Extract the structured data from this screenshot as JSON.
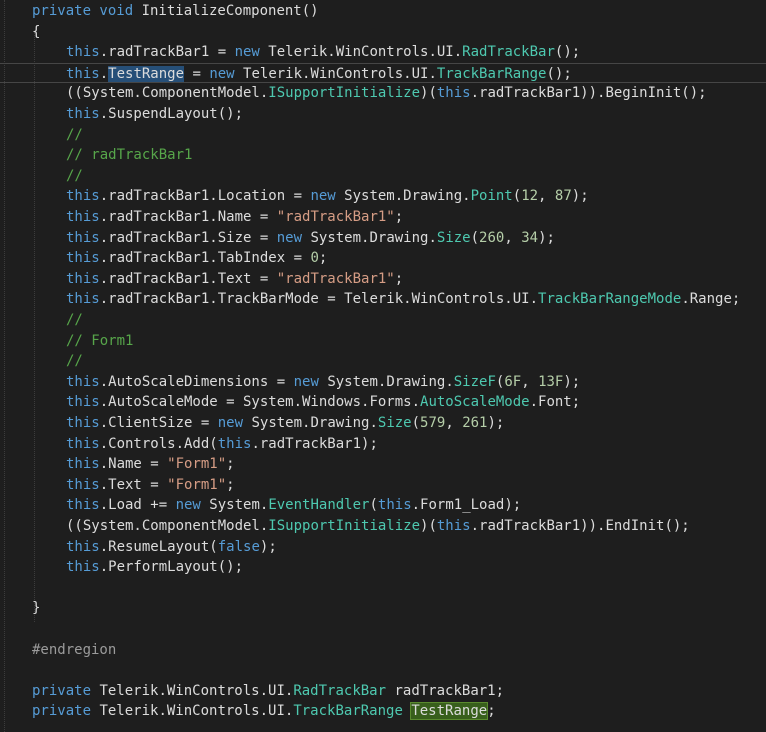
{
  "editor": {
    "lines": [
      {
        "indent": 32,
        "tokens": [
          {
            "t": "private void ",
            "c": "kw"
          },
          {
            "t": "InitializeComponent()",
            "c": "id"
          }
        ]
      },
      {
        "indent": 32,
        "tokens": [
          {
            "t": "{",
            "c": "id"
          }
        ]
      },
      {
        "indent": 66,
        "tokens": [
          {
            "t": "this",
            "c": "kw"
          },
          {
            "t": ".radTrackBar1 = ",
            "c": "id"
          },
          {
            "t": "new",
            "c": "kw"
          },
          {
            "t": " Telerik.WinControls.UI.",
            "c": "id"
          },
          {
            "t": "RadTrackBar",
            "c": "ty"
          },
          {
            "t": "();",
            "c": "id"
          }
        ]
      },
      {
        "indent": 66,
        "current": true,
        "tokens": [
          {
            "t": "this",
            "c": "kw"
          },
          {
            "t": ".",
            "c": "id"
          },
          {
            "t": "TestRange",
            "c": "id",
            "hl": "ref"
          },
          {
            "t": " = ",
            "c": "id"
          },
          {
            "t": "new",
            "c": "kw"
          },
          {
            "t": " Telerik.WinControls.UI.",
            "c": "id"
          },
          {
            "t": "TrackBarRange",
            "c": "ty"
          },
          {
            "t": "();",
            "c": "id"
          }
        ]
      },
      {
        "indent": 66,
        "tokens": [
          {
            "t": "((System.ComponentModel.",
            "c": "id"
          },
          {
            "t": "ISupportInitialize",
            "c": "ty"
          },
          {
            "t": ")(",
            "c": "id"
          },
          {
            "t": "this",
            "c": "kw"
          },
          {
            "t": ".radTrackBar1)).BeginInit();",
            "c": "id"
          }
        ]
      },
      {
        "indent": 66,
        "tokens": [
          {
            "t": "this",
            "c": "kw"
          },
          {
            "t": ".SuspendLayout();",
            "c": "id"
          }
        ]
      },
      {
        "indent": 66,
        "tokens": [
          {
            "t": "//",
            "c": "cm"
          }
        ]
      },
      {
        "indent": 66,
        "tokens": [
          {
            "t": "// radTrackBar1",
            "c": "cm"
          }
        ]
      },
      {
        "indent": 66,
        "tokens": [
          {
            "t": "//",
            "c": "cm"
          }
        ]
      },
      {
        "indent": 66,
        "tokens": [
          {
            "t": "this",
            "c": "kw"
          },
          {
            "t": ".radTrackBar1.Location = ",
            "c": "id"
          },
          {
            "t": "new",
            "c": "kw"
          },
          {
            "t": " System.Drawing.",
            "c": "id"
          },
          {
            "t": "Point",
            "c": "ty"
          },
          {
            "t": "(",
            "c": "id"
          },
          {
            "t": "12",
            "c": "num"
          },
          {
            "t": ", ",
            "c": "id"
          },
          {
            "t": "87",
            "c": "num"
          },
          {
            "t": ");",
            "c": "id"
          }
        ]
      },
      {
        "indent": 66,
        "tokens": [
          {
            "t": "this",
            "c": "kw"
          },
          {
            "t": ".radTrackBar1.Name = ",
            "c": "id"
          },
          {
            "t": "\"radTrackBar1\"",
            "c": "str"
          },
          {
            "t": ";",
            "c": "id"
          }
        ]
      },
      {
        "indent": 66,
        "tokens": [
          {
            "t": "this",
            "c": "kw"
          },
          {
            "t": ".radTrackBar1.Size = ",
            "c": "id"
          },
          {
            "t": "new",
            "c": "kw"
          },
          {
            "t": " System.Drawing.",
            "c": "id"
          },
          {
            "t": "Size",
            "c": "ty"
          },
          {
            "t": "(",
            "c": "id"
          },
          {
            "t": "260",
            "c": "num"
          },
          {
            "t": ", ",
            "c": "id"
          },
          {
            "t": "34",
            "c": "num"
          },
          {
            "t": ");",
            "c": "id"
          }
        ]
      },
      {
        "indent": 66,
        "tokens": [
          {
            "t": "this",
            "c": "kw"
          },
          {
            "t": ".radTrackBar1.TabIndex = ",
            "c": "id"
          },
          {
            "t": "0",
            "c": "num"
          },
          {
            "t": ";",
            "c": "id"
          }
        ]
      },
      {
        "indent": 66,
        "tokens": [
          {
            "t": "this",
            "c": "kw"
          },
          {
            "t": ".radTrackBar1.Text = ",
            "c": "id"
          },
          {
            "t": "\"radTrackBar1\"",
            "c": "str"
          },
          {
            "t": ";",
            "c": "id"
          }
        ]
      },
      {
        "indent": 66,
        "tokens": [
          {
            "t": "this",
            "c": "kw"
          },
          {
            "t": ".radTrackBar1.TrackBarMode = Telerik.WinControls.UI.",
            "c": "id"
          },
          {
            "t": "TrackBarRangeMode",
            "c": "ty"
          },
          {
            "t": ".Range;",
            "c": "id"
          }
        ]
      },
      {
        "indent": 66,
        "tokens": [
          {
            "t": "//",
            "c": "cm"
          }
        ]
      },
      {
        "indent": 66,
        "tokens": [
          {
            "t": "// Form1",
            "c": "cm"
          }
        ]
      },
      {
        "indent": 66,
        "tokens": [
          {
            "t": "//",
            "c": "cm"
          }
        ]
      },
      {
        "indent": 66,
        "tokens": [
          {
            "t": "this",
            "c": "kw"
          },
          {
            "t": ".AutoScaleDimensions = ",
            "c": "id"
          },
          {
            "t": "new",
            "c": "kw"
          },
          {
            "t": " System.Drawing.",
            "c": "id"
          },
          {
            "t": "SizeF",
            "c": "ty"
          },
          {
            "t": "(",
            "c": "id"
          },
          {
            "t": "6F",
            "c": "num"
          },
          {
            "t": ", ",
            "c": "id"
          },
          {
            "t": "13F",
            "c": "num"
          },
          {
            "t": ");",
            "c": "id"
          }
        ]
      },
      {
        "indent": 66,
        "tokens": [
          {
            "t": "this",
            "c": "kw"
          },
          {
            "t": ".AutoScaleMode = System.Windows.Forms.",
            "c": "id"
          },
          {
            "t": "AutoScaleMode",
            "c": "ty"
          },
          {
            "t": ".Font;",
            "c": "id"
          }
        ]
      },
      {
        "indent": 66,
        "tokens": [
          {
            "t": "this",
            "c": "kw"
          },
          {
            "t": ".ClientSize = ",
            "c": "id"
          },
          {
            "t": "new",
            "c": "kw"
          },
          {
            "t": " System.Drawing.",
            "c": "id"
          },
          {
            "t": "Size",
            "c": "ty"
          },
          {
            "t": "(",
            "c": "id"
          },
          {
            "t": "579",
            "c": "num"
          },
          {
            "t": ", ",
            "c": "id"
          },
          {
            "t": "261",
            "c": "num"
          },
          {
            "t": ");",
            "c": "id"
          }
        ]
      },
      {
        "indent": 66,
        "tokens": [
          {
            "t": "this",
            "c": "kw"
          },
          {
            "t": ".Controls.Add(",
            "c": "id"
          },
          {
            "t": "this",
            "c": "kw"
          },
          {
            "t": ".radTrackBar1);",
            "c": "id"
          }
        ]
      },
      {
        "indent": 66,
        "tokens": [
          {
            "t": "this",
            "c": "kw"
          },
          {
            "t": ".Name = ",
            "c": "id"
          },
          {
            "t": "\"Form1\"",
            "c": "str"
          },
          {
            "t": ";",
            "c": "id"
          }
        ]
      },
      {
        "indent": 66,
        "tokens": [
          {
            "t": "this",
            "c": "kw"
          },
          {
            "t": ".Text = ",
            "c": "id"
          },
          {
            "t": "\"Form1\"",
            "c": "str"
          },
          {
            "t": ";",
            "c": "id"
          }
        ]
      },
      {
        "indent": 66,
        "tokens": [
          {
            "t": "this",
            "c": "kw"
          },
          {
            "t": ".Load += ",
            "c": "id"
          },
          {
            "t": "new",
            "c": "kw"
          },
          {
            "t": " System.",
            "c": "id"
          },
          {
            "t": "EventHandler",
            "c": "ty"
          },
          {
            "t": "(",
            "c": "id"
          },
          {
            "t": "this",
            "c": "kw"
          },
          {
            "t": ".Form1_Load);",
            "c": "id"
          }
        ]
      },
      {
        "indent": 66,
        "tokens": [
          {
            "t": "((System.ComponentModel.",
            "c": "id"
          },
          {
            "t": "ISupportInitialize",
            "c": "ty"
          },
          {
            "t": ")(",
            "c": "id"
          },
          {
            "t": "this",
            "c": "kw"
          },
          {
            "t": ".radTrackBar1)).EndInit();",
            "c": "id"
          }
        ]
      },
      {
        "indent": 66,
        "tokens": [
          {
            "t": "this",
            "c": "kw"
          },
          {
            "t": ".ResumeLayout(",
            "c": "id"
          },
          {
            "t": "false",
            "c": "kw"
          },
          {
            "t": ");",
            "c": "id"
          }
        ]
      },
      {
        "indent": 66,
        "tokens": [
          {
            "t": "this",
            "c": "kw"
          },
          {
            "t": ".PerformLayout();",
            "c": "id"
          }
        ]
      },
      {
        "indent": 32,
        "tokens": []
      },
      {
        "indent": 32,
        "tokens": [
          {
            "t": "}",
            "c": "id"
          }
        ]
      },
      {
        "indent": 32,
        "tokens": []
      },
      {
        "indent": 32,
        "tokens": [
          {
            "t": "#endregion",
            "c": "pp"
          }
        ]
      },
      {
        "indent": 32,
        "tokens": []
      },
      {
        "indent": 32,
        "tokens": [
          {
            "t": "private",
            "c": "kw"
          },
          {
            "t": " Telerik.WinControls.UI.",
            "c": "id"
          },
          {
            "t": "RadTrackBar",
            "c": "ty"
          },
          {
            "t": " radTrackBar1;",
            "c": "id"
          }
        ]
      },
      {
        "indent": 32,
        "tokens": [
          {
            "t": "private",
            "c": "kw"
          },
          {
            "t": " Telerik.WinControls.UI.",
            "c": "id"
          },
          {
            "t": "TrackBarRange",
            "c": "ty"
          },
          {
            "t": " ",
            "c": "id"
          },
          {
            "t": "TestRange",
            "c": "id",
            "hl": "def"
          },
          {
            "t": ";",
            "c": "id"
          }
        ]
      }
    ]
  }
}
